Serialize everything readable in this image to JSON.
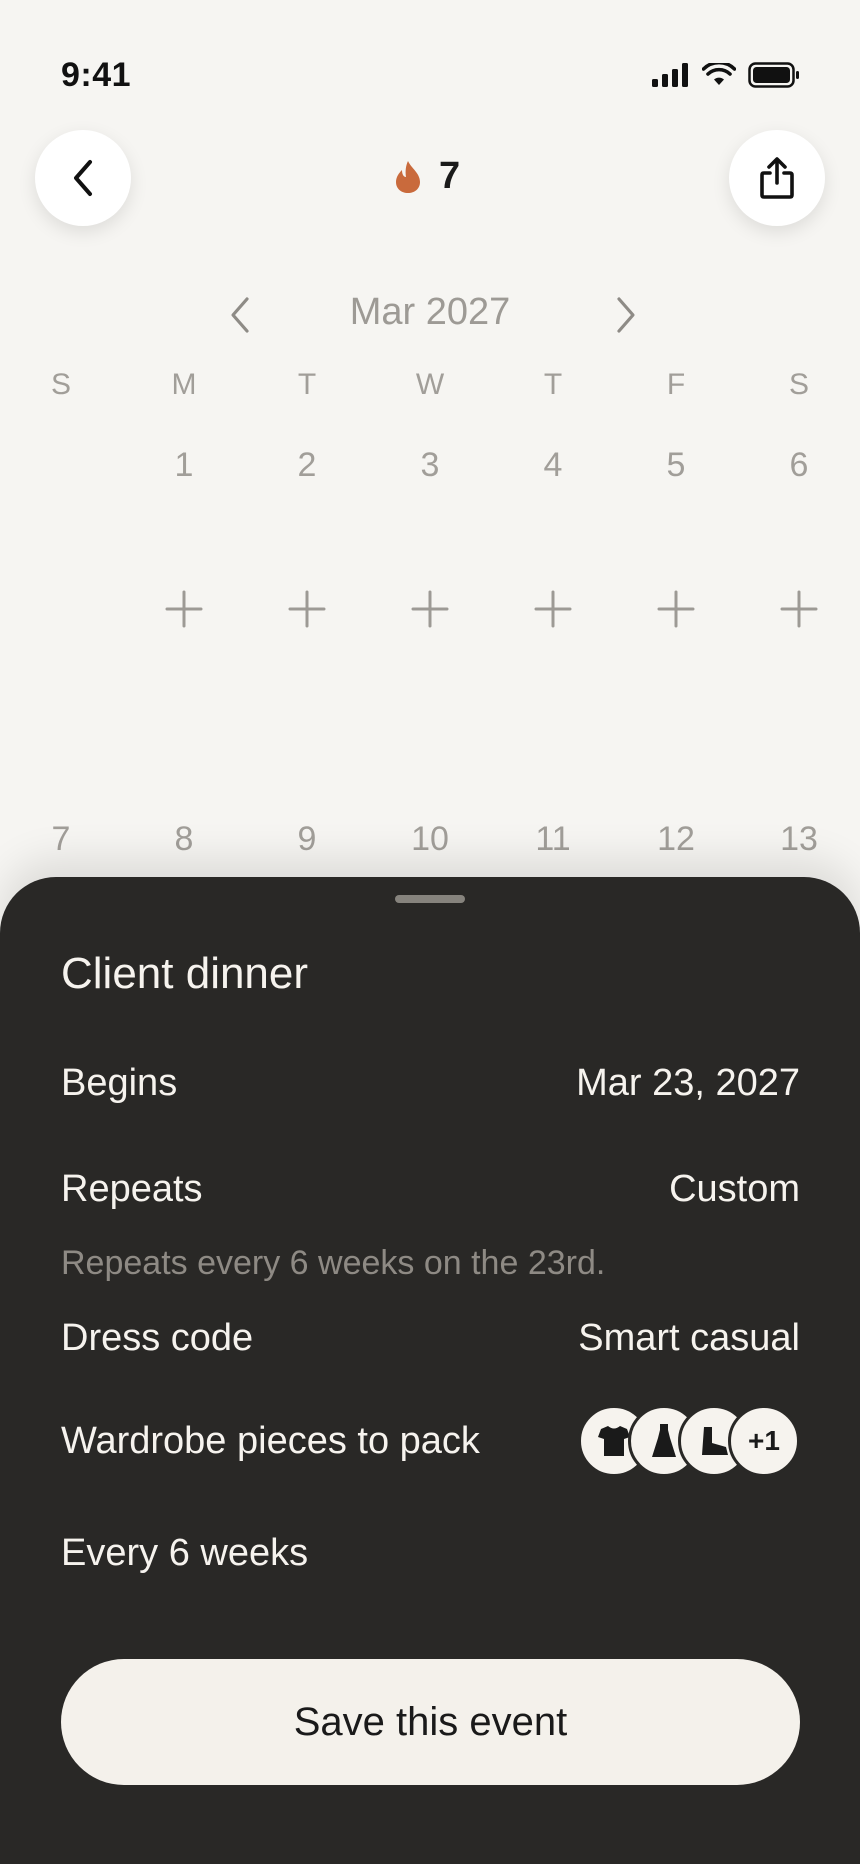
{
  "status_bar": {
    "time": "9:41"
  },
  "header": {
    "streak_count": "7",
    "accent_color": "#c96a3c"
  },
  "calendar": {
    "month_label": "Mar 2027",
    "weekdays": [
      "S",
      "M",
      "T",
      "W",
      "T",
      "F",
      "S"
    ],
    "week1": [
      "",
      "1",
      "2",
      "3",
      "4",
      "5",
      "6"
    ],
    "week2": [
      "7",
      "8",
      "9",
      "10",
      "11",
      "12",
      "13"
    ]
  },
  "sheet": {
    "title": "Client dinner",
    "begins_label": "Begins",
    "begins_value": "Mar 23, 2027",
    "repeats_label": "Repeats",
    "repeats_value": "Custom",
    "repeat_note": "Repeats every 6 weeks on the 23rd.",
    "dress_label": "Dress code",
    "dress_value": "Smart casual",
    "wardrobe_label": "Wardrobe pieces to pack",
    "wardrobe_items": [
      "tshirt-icon",
      "dress-icon",
      "boot-icon"
    ],
    "wardrobe_more": "+1",
    "every_label": "Every 6 weeks",
    "save_label": "Save this event"
  }
}
